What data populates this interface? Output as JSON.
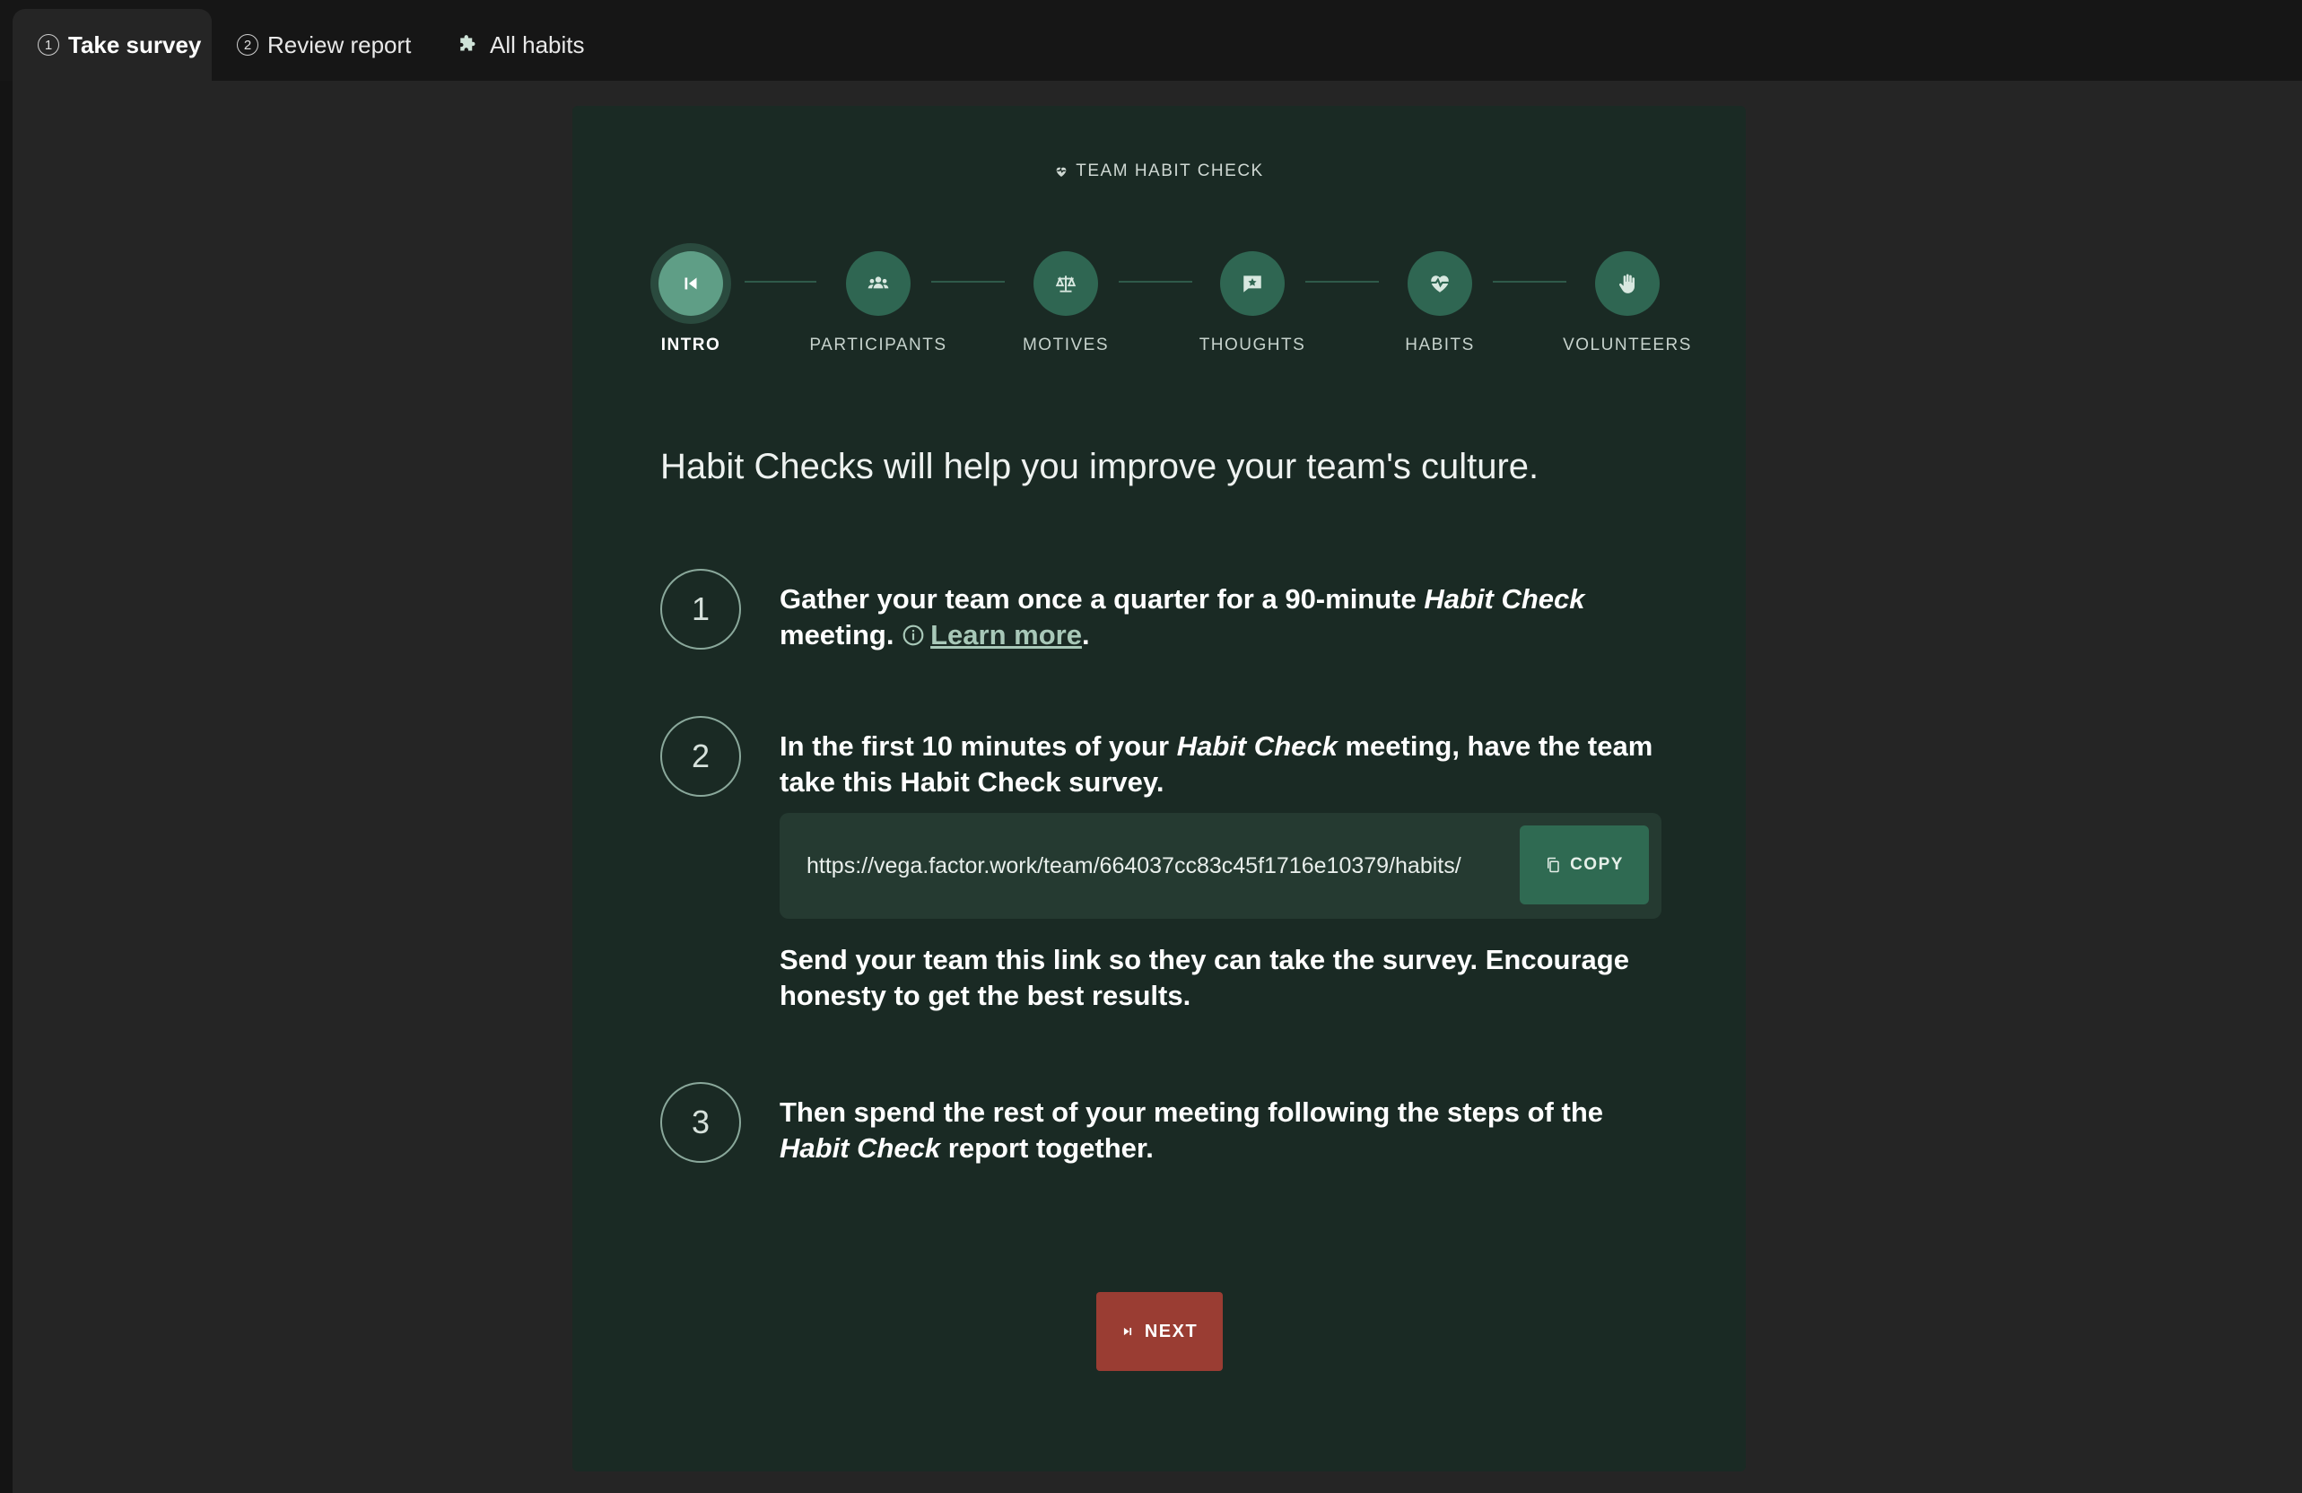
{
  "tabs": [
    {
      "num": "1",
      "label": "Take survey",
      "active": true
    },
    {
      "num": "2",
      "label": "Review report",
      "active": false
    },
    {
      "icon": "puzzle-icon",
      "label": "All habits",
      "active": false
    }
  ],
  "card": {
    "kicker": "TEAM HABIT CHECK",
    "steps": [
      {
        "label": "INTRO",
        "icon": "skip-back-icon",
        "active": true
      },
      {
        "label": "PARTICIPANTS",
        "icon": "people-icon",
        "active": false
      },
      {
        "label": "MOTIVES",
        "icon": "scales-icon",
        "active": false
      },
      {
        "label": "THOUGHTS",
        "icon": "speech-star-icon",
        "active": false
      },
      {
        "label": "HABITS",
        "icon": "heart-pulse-icon",
        "active": false
      },
      {
        "label": "VOLUNTEERS",
        "icon": "raised-hand-icon",
        "active": false
      }
    ],
    "headline": "Habit Checks will help you improve your team's culture.",
    "items": [
      {
        "num": "1",
        "text_a": "Gather your team once a quarter for a 90-minute ",
        "text_em": "Habit Check",
        "text_b": " meeting. ",
        "learn_more": "Learn more",
        "text_c": "."
      },
      {
        "num": "2",
        "text_a": "In the first 10 minutes of your ",
        "text_em": "Habit Check",
        "text_b": " meeting, have the team take this Habit Check survey."
      },
      {
        "num": "3",
        "text_a": "Then spend the rest of your meeting following the steps of the ",
        "text_em": "Habit Check",
        "text_b": " report together."
      }
    ],
    "survey_link": "https://vega.factor.work/team/664037cc83c45f1716e10379/habits/",
    "copy_label": "COPY",
    "send_text": "Send your team this link so they can take the survey. Encourage honesty to get the best results.",
    "next_label": "NEXT"
  }
}
